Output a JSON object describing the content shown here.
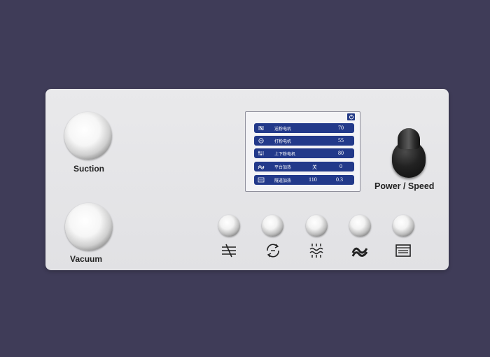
{
  "panel": {
    "suction_label": "Suction",
    "vacuum_label": "Vacuum",
    "power_speed_label": "Power / Speed"
  },
  "screen": {
    "power_icon": "power-icon",
    "rows": [
      {
        "icon": "powder-feed-icon",
        "label": "送粉电机",
        "value1": "",
        "value2": "70"
      },
      {
        "icon": "powder-beat-icon",
        "label": "打粉电机",
        "value1": "",
        "value2": "55"
      },
      {
        "icon": "up-down-icon",
        "label": "上下粉电机",
        "value1": "",
        "value2": "80"
      },
      {
        "icon": "platform-heat-icon",
        "label": "平台加热",
        "value1": "关",
        "value2": "0"
      },
      {
        "icon": "tunnel-heat-icon",
        "label": "隧道加热",
        "value1": "110",
        "value2": "0.3"
      }
    ]
  },
  "knob_icons": [
    "powder-feed-icon",
    "rotate-cycle-icon",
    "up-down-heat-icon",
    "platform-heat-icon",
    "tunnel-oven-icon"
  ],
  "colors": {
    "background": "#3f3c58",
    "panel": "#e6e6e8",
    "screen_row": "#22398a"
  }
}
